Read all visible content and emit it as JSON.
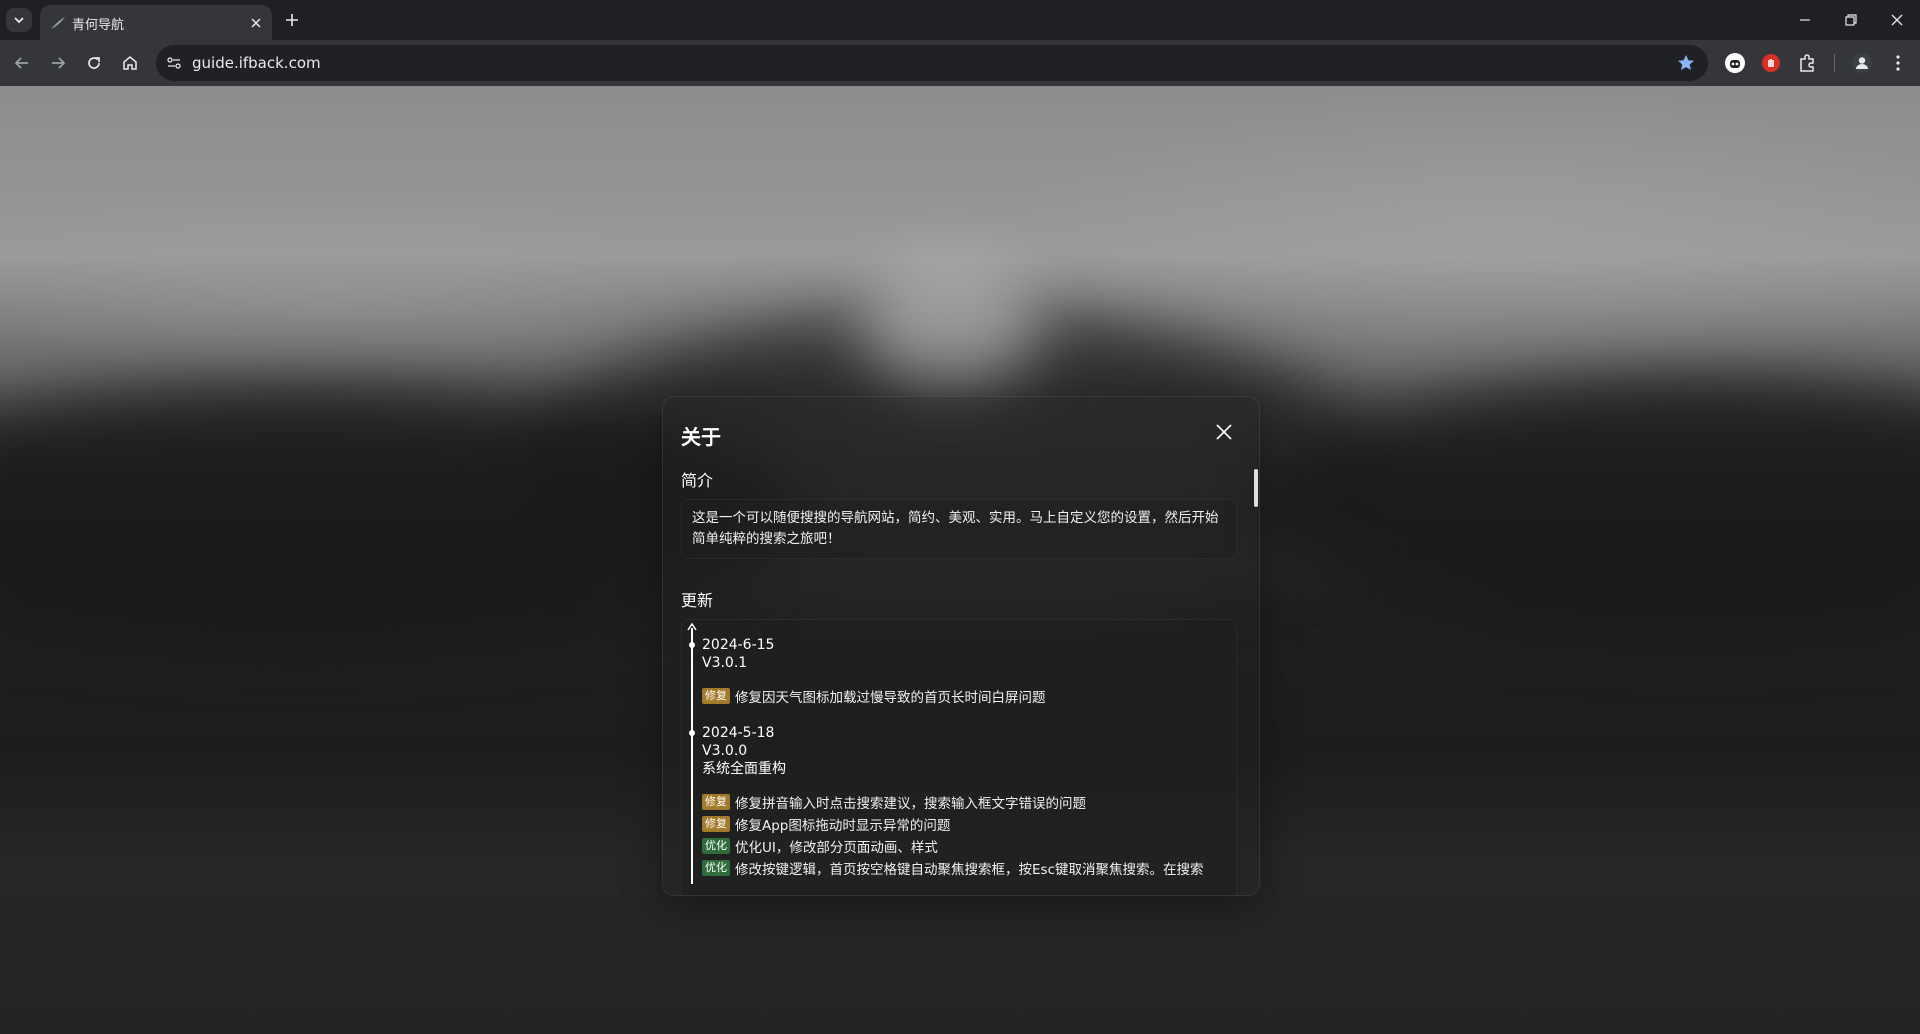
{
  "browser": {
    "tab_title": "青何导航",
    "url": "guide.ifback.com"
  },
  "colors": {
    "fix_badge": "#a17a2a",
    "optimize_badge": "#2f6c3c",
    "bookmark_star": "#8ab4f8"
  },
  "modal": {
    "title": "关于",
    "intro_label": "简介",
    "intro_text": "这是一个可以随便搜搜的导航网站，简约、美观、实用。马上自定义您的设置，然后开始简单纯粹的搜索之旅吧！",
    "updates_label": "更新",
    "updates": [
      {
        "date": "2024-6-15",
        "version": "V3.0.1",
        "changes": [
          {
            "tag": "修复",
            "type": "fix",
            "text": "修复因天气图标加载过慢导致的首页长时间白屏问题"
          }
        ]
      },
      {
        "date": "2024-5-18",
        "version": "V3.0.0",
        "summary": "系统全面重构",
        "changes": [
          {
            "tag": "修复",
            "type": "fix",
            "text": "修复拼音输入时点击搜索建议，搜索输入框文字错误的问题"
          },
          {
            "tag": "修复",
            "type": "fix",
            "text": "修复App图标拖动时显示异常的问题"
          },
          {
            "tag": "优化",
            "type": "opt",
            "text": "优化UI，修改部分页面动画、样式"
          },
          {
            "tag": "优化",
            "type": "opt",
            "text": "修改按键逻辑，首页按空格键自动聚焦搜索框，按Esc键取消聚焦搜索。在搜索"
          }
        ]
      }
    ]
  }
}
